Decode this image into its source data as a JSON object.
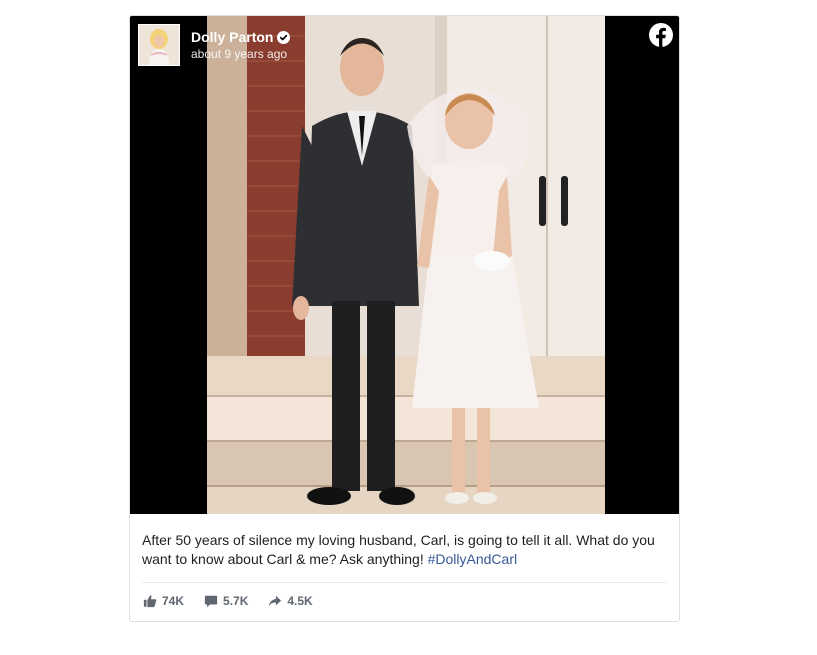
{
  "post": {
    "author": {
      "name": "Dolly Parton",
      "verified": true,
      "avatar": "avatar-photo"
    },
    "timestamp": "about 9 years ago",
    "platform_icon": "facebook-icon",
    "photo": "vintage wedding photo of a couple in front of a white church door",
    "caption": {
      "text": "After 50 years of silence my loving husband, Carl, is going to tell it all. What do you want to know about Carl & me? Ask anything!",
      "hashtag": "#DollyAndCarl"
    },
    "stats": {
      "likes": {
        "icon": "thumbs-up-icon",
        "value": "74K"
      },
      "comments": {
        "icon": "comment-icon",
        "value": "5.7K"
      },
      "shares": {
        "icon": "share-arrow-icon",
        "value": "4.5K"
      }
    }
  },
  "colors": {
    "text": "#1c1e21",
    "hashtag": "#385898",
    "muted": "#606770",
    "border": "#dddfe2",
    "media_background": "#000000"
  }
}
